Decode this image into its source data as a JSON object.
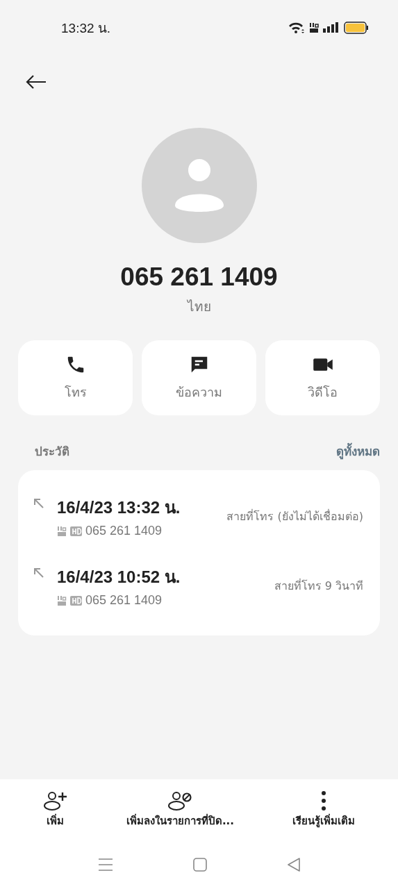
{
  "status_bar": {
    "time": "13:32 น."
  },
  "contact": {
    "number": "065 261 1409",
    "location": "ไทย"
  },
  "actions": [
    {
      "kind": "call",
      "label": "โทร"
    },
    {
      "kind": "message",
      "label": "ข้อความ"
    },
    {
      "kind": "video",
      "label": "วิดีโอ"
    }
  ],
  "history": {
    "title": "ประวัติ",
    "view_all": "ดูทั้งหมด",
    "calls": [
      {
        "datetime": "16/4/23 13:32 น.",
        "number": "065 261 1409",
        "status": "สายที่โทร (ยังไม่ได้เชื่อมต่อ)"
      },
      {
        "datetime": "16/4/23 10:52 น.",
        "number": "065 261 1409",
        "status": "สายที่โทร  9 วินาที"
      }
    ]
  },
  "bottom_actions": [
    {
      "kind": "add",
      "label": "เพิ่ม"
    },
    {
      "kind": "block",
      "label": "เพิ่มลงในรายการที่ปิด..."
    },
    {
      "kind": "more",
      "label": "เรียนรู้เพิ่มเติม"
    }
  ]
}
